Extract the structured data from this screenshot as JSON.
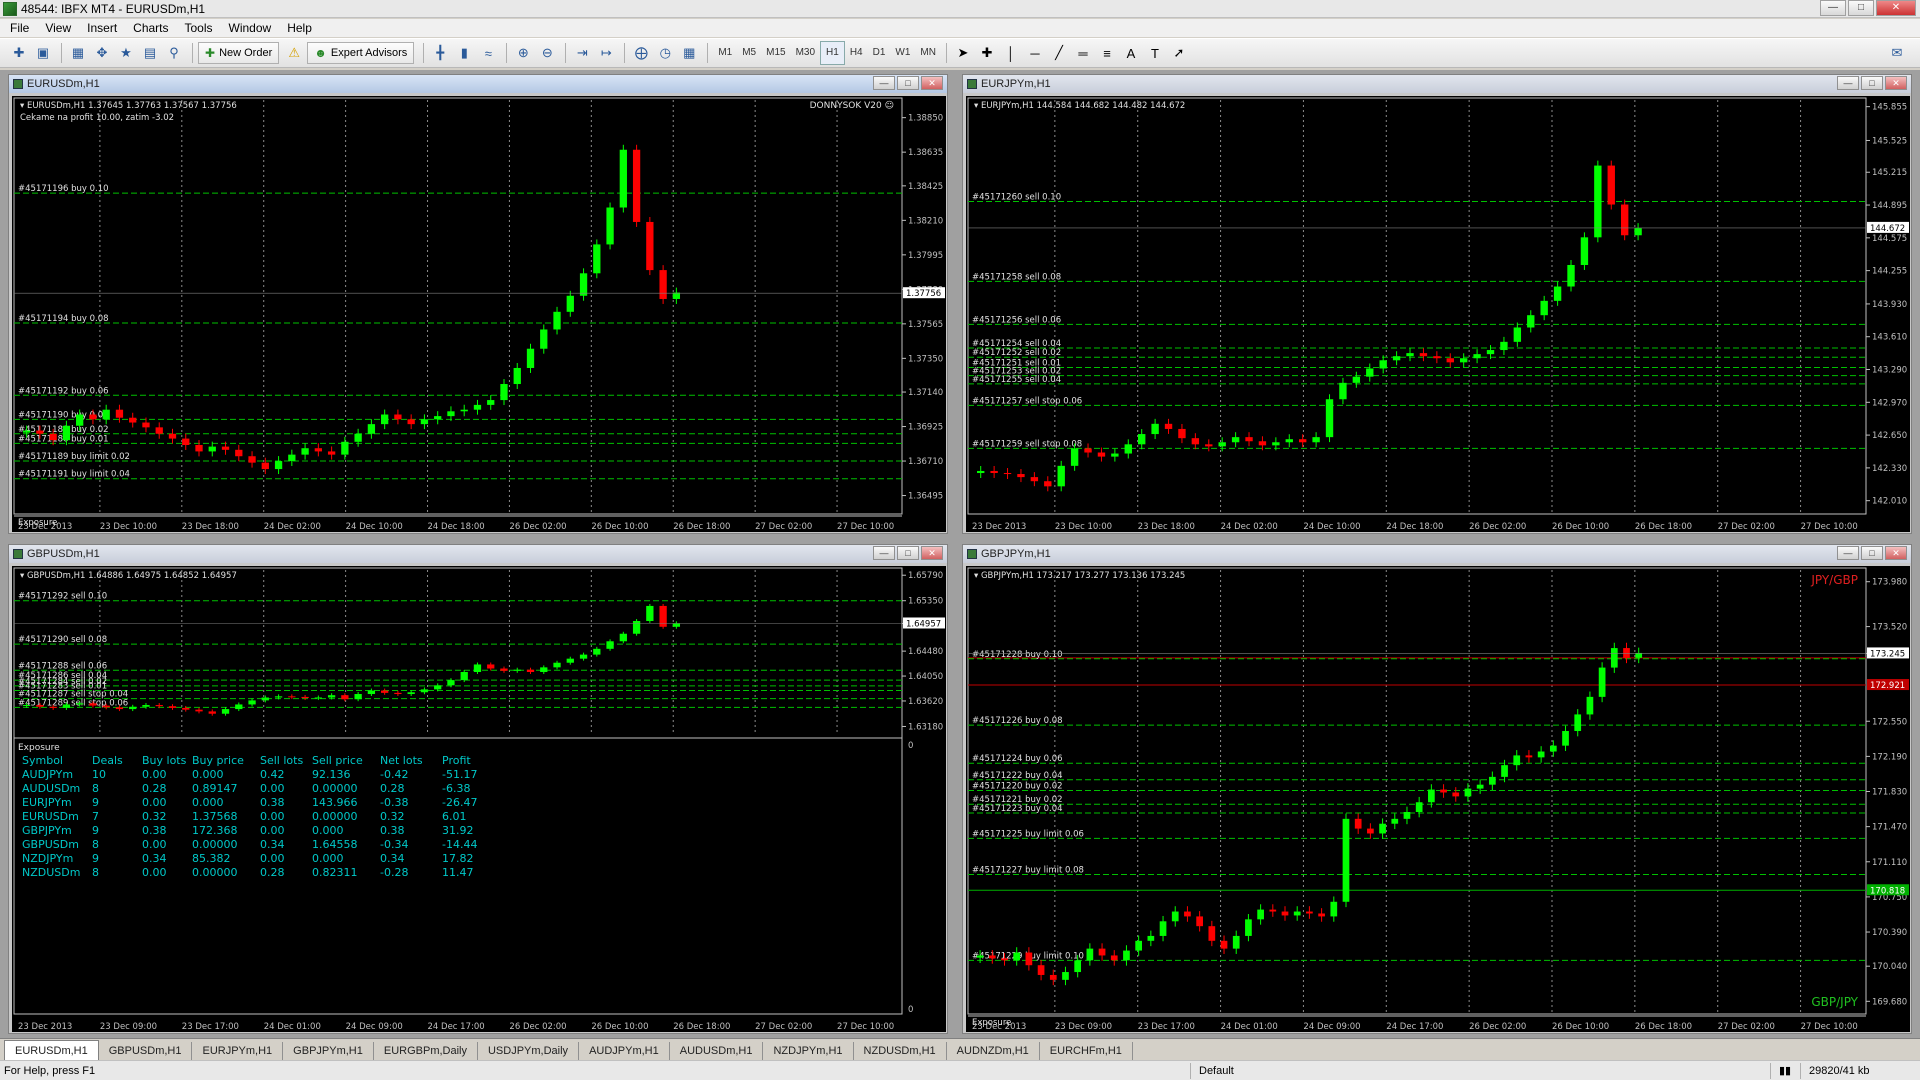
{
  "window": {
    "title": "48544: IBFX MT4 - EURUSDm,H1"
  },
  "menu": [
    "File",
    "View",
    "Insert",
    "Charts",
    "Tools",
    "Window",
    "Help"
  ],
  "toolbar": {
    "new_order": "New Order",
    "expert_advisors": "Expert Advisors",
    "timeframes": [
      "M1",
      "M5",
      "M15",
      "M30",
      "H1",
      "H4",
      "D1",
      "W1",
      "MN"
    ],
    "selected_timeframe": "H1"
  },
  "charts": [
    {
      "id": "eurusd",
      "title": "EURUSDm,H1",
      "info_line": "EURUSDm,H1  1.37645 1.37763 1.37567 1.37756",
      "comment": "Cekame na profit 10.00, zatim -3.02",
      "ea_label": "DONNYSOK V20",
      "corner_labels": [],
      "y_ticks": [
        "1.38850",
        "1.38635",
        "1.38425",
        "1.38210",
        "1.37995",
        "1.37780",
        "1.37565",
        "1.37350",
        "1.37140",
        "1.36925",
        "1.36710",
        "1.36495"
      ],
      "y_min": 1.3638,
      "y_max": 1.3896,
      "current_price": "1.37756",
      "x_ticks": [
        "23 Dec 2013",
        "23 Dec 10:00",
        "23 Dec 18:00",
        "24 Dec 02:00",
        "24 Dec 10:00",
        "24 Dec 18:00",
        "26 Dec 02:00",
        "26 Dec 10:00",
        "26 Dec 18:00",
        "27 Dec 02:00",
        "27 Dec 10:00"
      ],
      "order_lines": [
        {
          "label": "#45171196 buy 0.10",
          "price": 1.3838
        },
        {
          "label": "#45171194 buy 0.08",
          "price": 1.3757
        },
        {
          "label": "#45171192 buy 0.06",
          "price": 1.3712
        },
        {
          "label": "#45171190 buy 0.04",
          "price": 1.3697
        },
        {
          "label": "#45171188 buy 0.02",
          "price": 1.3688
        },
        {
          "label": "#45171186 buy 0.01",
          "price": 1.3682
        },
        {
          "label": "#45171189 buy limit 0.02",
          "price": 1.3671
        },
        {
          "label": "#45171191 buy limit 0.04",
          "price": 1.366
        }
      ],
      "price_line_colors": [],
      "exposure_label": "Exposure",
      "candles": [
        1.369,
        1.3688,
        1.3684,
        1.3693,
        1.37,
        1.3697,
        1.3703,
        1.3698,
        1.3695,
        1.3692,
        1.3688,
        1.3685,
        1.3681,
        1.3677,
        1.368,
        1.3678,
        1.3674,
        1.367,
        1.3666,
        1.3671,
        1.3675,
        1.3679,
        1.3677,
        1.3675,
        1.3683,
        1.3688,
        1.3694,
        1.37,
        1.3697,
        1.3694,
        1.3697,
        1.3699,
        1.3702,
        1.3703,
        1.3706,
        1.3709,
        1.3719,
        1.3729,
        1.3741,
        1.3753,
        1.3764,
        1.3774,
        1.3788,
        1.3806,
        1.3829,
        1.3865,
        1.382,
        1.379,
        1.3772,
        1.3776
      ]
    },
    {
      "id": "eurjpy",
      "title": "EURJPYm,H1",
      "info_line": "EURJPYm,H1  144.584 144.682 144.482 144.672",
      "comment": "",
      "ea_label": "",
      "corner_labels": [],
      "y_ticks": [
        "145.855",
        "145.525",
        "145.215",
        "144.895",
        "144.575",
        "144.255",
        "143.930",
        "143.610",
        "143.290",
        "142.970",
        "142.650",
        "142.330",
        "142.010"
      ],
      "y_min": 141.88,
      "y_max": 145.92,
      "current_price": "144.672",
      "x_ticks": [
        "23 Dec 2013",
        "23 Dec 10:00",
        "23 Dec 18:00",
        "24 Dec 02:00",
        "24 Dec 10:00",
        "24 Dec 18:00",
        "26 Dec 02:00",
        "26 Dec 10:00",
        "26 Dec 18:00",
        "27 Dec 02:00",
        "27 Dec 10:00"
      ],
      "order_lines": [
        {
          "label": "#45171260 sell 0.10",
          "price": 144.93
        },
        {
          "label": "#45171258 sell 0.08",
          "price": 144.15
        },
        {
          "label": "#45171256 sell 0.06",
          "price": 143.73
        },
        {
          "label": "#45171254 sell 0.04",
          "price": 143.5
        },
        {
          "label": "#45171252 sell 0.02",
          "price": 143.41
        },
        {
          "label": "#45171251 sell 0.01",
          "price": 143.31
        },
        {
          "label": "#45171253 sell 0.02",
          "price": 143.23
        },
        {
          "label": "#45171255 sell 0.04",
          "price": 143.15
        },
        {
          "label": "#45171257 sell stop 0.06",
          "price": 142.94
        },
        {
          "label": "#45171259 sell stop 0.08",
          "price": 142.52
        }
      ],
      "price_line_colors": [],
      "exposure_label": "",
      "candles": [
        142.3,
        142.28,
        142.27,
        142.24,
        142.2,
        142.15,
        142.35,
        142.52,
        142.48,
        142.44,
        142.47,
        142.56,
        142.66,
        142.76,
        142.71,
        142.62,
        142.56,
        142.54,
        142.58,
        142.63,
        142.59,
        142.55,
        142.58,
        142.61,
        142.58,
        142.63,
        143.0,
        143.16,
        143.22,
        143.3,
        143.38,
        143.42,
        143.45,
        143.42,
        143.4,
        143.36,
        143.4,
        143.44,
        143.48,
        143.56,
        143.7,
        143.82,
        143.96,
        144.1,
        144.31,
        144.58,
        145.28,
        144.9,
        144.6,
        144.67
      ]
    },
    {
      "id": "gbpusd",
      "title": "GBPUSDm,H1",
      "info_line": "GBPUSDm,H1  1.64886 1.64975 1.64852 1.64957",
      "comment": "",
      "ea_label": "",
      "corner_labels": [],
      "y_ticks": [
        "1.65790",
        "1.65350",
        "1.64957",
        "1.64480",
        "1.64050",
        "1.63620",
        "1.63180"
      ],
      "y_min": 1.6305,
      "y_max": 1.6588,
      "current_price": "1.64957",
      "x_ticks": [
        "23 Dec 2013",
        "23 Dec 09:00",
        "23 Dec 17:00",
        "24 Dec 01:00",
        "24 Dec 09:00",
        "24 Dec 17:00",
        "26 Dec 02:00",
        "26 Dec 10:00",
        "26 Dec 18:00",
        "27 Dec 02:00",
        "27 Dec 10:00"
      ],
      "order_lines": [
        {
          "label": "#45171292 sell 0.10",
          "price": 1.6535
        },
        {
          "label": "#45171290 sell 0.08",
          "price": 1.646
        },
        {
          "label": "#45171288 sell 0.06",
          "price": 1.6415
        },
        {
          "label": "#45171286 sell 0.04",
          "price": 1.6398
        },
        {
          "label": "#45171284 sell 0.02",
          "price": 1.6388
        },
        {
          "label": "#45171283 sell 0.01",
          "price": 1.638
        },
        {
          "label": "#45171287 sell stop 0.04",
          "price": 1.6366
        },
        {
          "label": "#45171289 sell stop 0.06",
          "price": 1.6351
        }
      ],
      "price_line_colors": [],
      "exposure_label": "",
      "candles": [
        1.6355,
        1.6352,
        1.635,
        1.6356,
        1.6358,
        1.6354,
        1.6351,
        1.6348,
        1.6352,
        1.6355,
        1.6353,
        1.635,
        1.6347,
        1.6344,
        1.634,
        1.6348,
        1.6356,
        1.6363,
        1.6368,
        1.637,
        1.6369,
        1.6367,
        1.6368,
        1.6372,
        1.6365,
        1.6374,
        1.638,
        1.6376,
        1.6374,
        1.6377,
        1.6382,
        1.6389,
        1.6398,
        1.6412,
        1.6425,
        1.6418,
        1.6414,
        1.6416,
        1.6412,
        1.642,
        1.6428,
        1.6435,
        1.6442,
        1.6452,
        1.6465,
        1.6478,
        1.65,
        1.6526,
        1.649,
        1.6496
      ]
    },
    {
      "id": "gbpjpy",
      "title": "GBPJPYm,H1",
      "info_line": "GBPJPYm,H1  173.217 173.277 173.136 173.245",
      "comment": "",
      "ea_label": "",
      "corner_labels": [
        {
          "text": "JPY/GBP",
          "color": "#e02020",
          "pos": "top-right"
        },
        {
          "text": "GBP/JPY",
          "color": "#20c020",
          "pos": "bottom-right"
        }
      ],
      "y_ticks": [
        "173.980",
        "173.520",
        "173.245",
        "172.550",
        "172.190",
        "171.830",
        "171.470",
        "171.110",
        "170.750",
        "170.390",
        "170.040",
        "169.680"
      ],
      "y_min": 169.55,
      "y_max": 174.1,
      "current_price": "173.245",
      "x_ticks": [
        "23 Dec 2013",
        "23 Dec 09:00",
        "23 Dec 17:00",
        "24 Dec 01:00",
        "24 Dec 09:00",
        "24 Dec 17:00",
        "26 Dec 02:00",
        "26 Dec 10:00",
        "26 Dec 18:00",
        "27 Dec 02:00",
        "27 Dec 10:00"
      ],
      "order_lines": [
        {
          "label": "#45171228 buy 0.10",
          "price": 173.19
        },
        {
          "label": "#45171226 buy 0.08",
          "price": 172.51
        },
        {
          "label": "#45171224 buy 0.06",
          "price": 172.12
        },
        {
          "label": "#45171222 buy 0.04",
          "price": 171.95
        },
        {
          "label": "#45171220 buy 0.02",
          "price": 171.84
        },
        {
          "label": "#45171221 buy 0.02",
          "price": 171.7
        },
        {
          "label": "#45171223 buy 0.04",
          "price": 171.61
        },
        {
          "label": "#45171225 buy limit 0.06",
          "price": 171.35
        },
        {
          "label": "#45171227 buy limit 0.08",
          "price": 170.98
        },
        {
          "label": "#45171229 buy limit 0.10",
          "price": 170.1
        }
      ],
      "price_line_colors": [
        {
          "price": 173.2,
          "color": "#c00000"
        },
        {
          "price": 172.921,
          "color": "#c00000",
          "label": "172.921"
        },
        {
          "price": 170.818,
          "color": "#00b000",
          "label": "170.818"
        }
      ],
      "exposure_label": "Exposure",
      "candles": [
        170.15,
        170.12,
        170.1,
        170.18,
        170.05,
        169.95,
        169.9,
        169.98,
        170.1,
        170.22,
        170.15,
        170.1,
        170.2,
        170.3,
        170.35,
        170.5,
        170.6,
        170.55,
        170.45,
        170.3,
        170.22,
        170.35,
        170.52,
        170.62,
        170.6,
        170.56,
        170.6,
        170.58,
        170.55,
        170.7,
        171.55,
        171.45,
        171.4,
        171.5,
        171.55,
        171.62,
        171.72,
        171.85,
        171.82,
        171.78,
        171.86,
        171.9,
        171.98,
        172.1,
        172.2,
        172.18,
        172.24,
        172.3,
        172.45,
        172.62,
        172.8,
        173.1,
        173.3,
        173.2,
        173.25
      ]
    }
  ],
  "exposure": {
    "title": "Exposure",
    "columns": [
      "Symbol",
      "Deals",
      "Buy lots",
      "Buy price",
      "Sell lots",
      "Sell price",
      "Net lots",
      "Profit"
    ],
    "rows": [
      [
        "AUDJPYm",
        "10",
        "0.00",
        "0.000",
        "0.42",
        "92.136",
        "-0.42",
        "-51.17"
      ],
      [
        "AUDUSDm",
        "8",
        "0.28",
        "0.89147",
        "0.00",
        "0.00000",
        "0.28",
        "-6.38"
      ],
      [
        "EURJPYm",
        "9",
        "0.00",
        "0.000",
        "0.38",
        "143.966",
        "-0.38",
        "-26.47"
      ],
      [
        "EURUSDm",
        "7",
        "0.32",
        "1.37568",
        "0.00",
        "0.00000",
        "0.32",
        "6.01"
      ],
      [
        "GBPJPYm",
        "9",
        "0.38",
        "172.368",
        "0.00",
        "0.000",
        "0.38",
        "31.92"
      ],
      [
        "GBPUSDm",
        "8",
        "0.00",
        "0.00000",
        "0.34",
        "1.64558",
        "-0.34",
        "-14.44"
      ],
      [
        "NZDJPYm",
        "9",
        "0.34",
        "85.382",
        "0.00",
        "0.000",
        "0.34",
        "17.82"
      ],
      [
        "NZDUSDm",
        "8",
        "0.00",
        "0.00000",
        "0.28",
        "0.82311",
        "-0.28",
        "11.47"
      ]
    ],
    "scale_top": "0",
    "scale_bottom": "0"
  },
  "tabs": [
    "EURUSDm,H1",
    "GBPUSDm,H1",
    "EURJPYm,H1",
    "GBPJPYm,H1",
    "EURGBPm,Daily",
    "USDJPYm,Daily",
    "AUDJPYm,H1",
    "AUDUSDm,H1",
    "NZDJPYm,H1",
    "NZDUSDm,H1",
    "AUDNZDm,H1",
    "EURCHFm,H1"
  ],
  "active_tab": "EURUSDm,H1",
  "status": {
    "help": "For Help, press F1",
    "profile": "Default",
    "traffic": "29820/41 kb"
  },
  "colors": {
    "bull": "#00ff00",
    "bear": "#ff0000",
    "grid": "#ffffff",
    "order_line": "#00c000",
    "chart_text": "#ffffff",
    "exposure_text": "#00c8c8"
  }
}
